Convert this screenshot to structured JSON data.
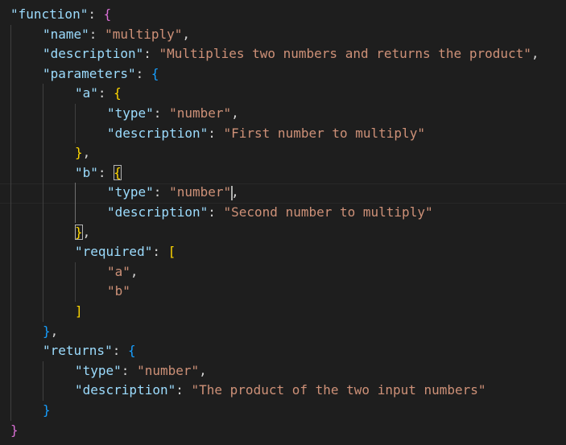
{
  "editor": {
    "lines": {
      "l1": {
        "key": "\"function\"",
        "colon": ": ",
        "open": "{"
      },
      "l2": {
        "key": "\"name\"",
        "colon": ": ",
        "val": "\"multiply\"",
        "comma": ","
      },
      "l3": {
        "key": "\"description\"",
        "colon": ": ",
        "val": "\"Multiplies two numbers and returns the product\"",
        "comma": ","
      },
      "l4": {
        "key": "\"parameters\"",
        "colon": ": ",
        "open": "{"
      },
      "l5": {
        "key": "\"a\"",
        "colon": ": ",
        "open": "{"
      },
      "l6": {
        "key": "\"type\"",
        "colon": ": ",
        "val": "\"number\"",
        "comma": ","
      },
      "l7": {
        "key": "\"description\"",
        "colon": ": ",
        "val": "\"First number to multiply\""
      },
      "l8": {
        "close": "}",
        "comma": ","
      },
      "l9": {
        "key": "\"b\"",
        "colon": ": ",
        "open": "{"
      },
      "l10": {
        "key": "\"type\"",
        "colon": ": ",
        "val": "\"number\"",
        "comma": ","
      },
      "l11": {
        "key": "\"description\"",
        "colon": ": ",
        "val": "\"Second number to multiply\""
      },
      "l12": {
        "close": "}",
        "comma": ","
      },
      "l13": {
        "key": "\"required\"",
        "colon": ": ",
        "open": "["
      },
      "l14": {
        "val": "\"a\"",
        "comma": ","
      },
      "l15": {
        "val": "\"b\""
      },
      "l16": {
        "close": "]"
      },
      "l17": {
        "close": "}",
        "comma": ","
      },
      "l18": {
        "key": "\"returns\"",
        "colon": ": ",
        "open": "{"
      },
      "l19": {
        "key": "\"type\"",
        "colon": ": ",
        "val": "\"number\"",
        "comma": ","
      },
      "l20": {
        "key": "\"description\"",
        "colon": ": ",
        "val": "\"The product of the two input numbers\""
      },
      "l21": {
        "close": "}"
      },
      "l22": {
        "close": "}"
      }
    },
    "colors": {
      "background": "#1e1e1e",
      "key": "#9cdcfe",
      "string": "#ce9178",
      "bracket_level1": "#da70d6",
      "bracket_level2": "#179fff",
      "bracket_level3": "#ffd700"
    }
  }
}
